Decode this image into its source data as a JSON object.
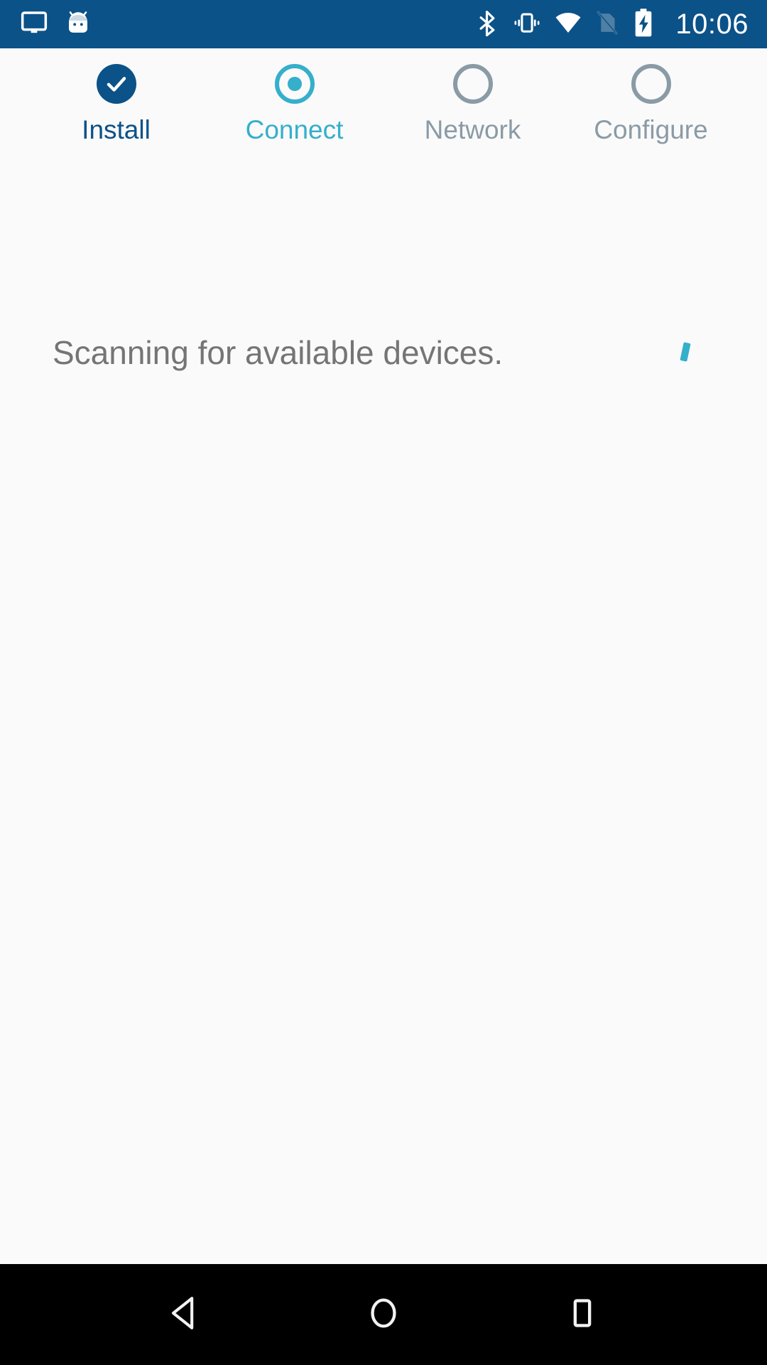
{
  "status_bar": {
    "background_color": "#0B5288",
    "left_icons": [
      {
        "name": "cast-screen-icon",
        "label": "cast"
      },
      {
        "name": "android-robot-head-icon",
        "label": "system"
      }
    ],
    "right_icons": [
      {
        "name": "bluetooth-icon",
        "label": "Bluetooth"
      },
      {
        "name": "vibrate-mode-icon",
        "label": "Vibrate"
      },
      {
        "name": "wifi-signal-icon",
        "label": "Wi-Fi full"
      },
      {
        "name": "no-sim-card-icon",
        "label": "No SIM"
      },
      {
        "name": "battery-charging-icon",
        "label": "Charging"
      }
    ],
    "clock": "10:06"
  },
  "stepper": {
    "accent_done": "#0B5288",
    "accent_active": "#35AFCB",
    "accent_todo": "#8A9BA6",
    "steps": [
      {
        "label": "Install",
        "state": "done",
        "icon": "check-icon"
      },
      {
        "label": "Connect",
        "state": "active",
        "icon": "radio-selected-icon"
      },
      {
        "label": "Network",
        "state": "todo",
        "icon": "radio-empty-icon"
      },
      {
        "label": "Configure",
        "state": "todo",
        "icon": "radio-empty-icon"
      }
    ]
  },
  "main": {
    "status_message": "Scanning for available devices.",
    "status_text_color": "#757575",
    "spinner": {
      "name": "indeterminate-progress-spinner",
      "color": "#35AFCB"
    },
    "background_color": "#FAFAFA"
  },
  "nav_bar": {
    "background_color": "#000000",
    "buttons": [
      {
        "name": "back-button",
        "icon": "triangle-left-icon"
      },
      {
        "name": "home-button",
        "icon": "circle-icon"
      },
      {
        "name": "recents-button",
        "icon": "square-icon"
      }
    ]
  }
}
